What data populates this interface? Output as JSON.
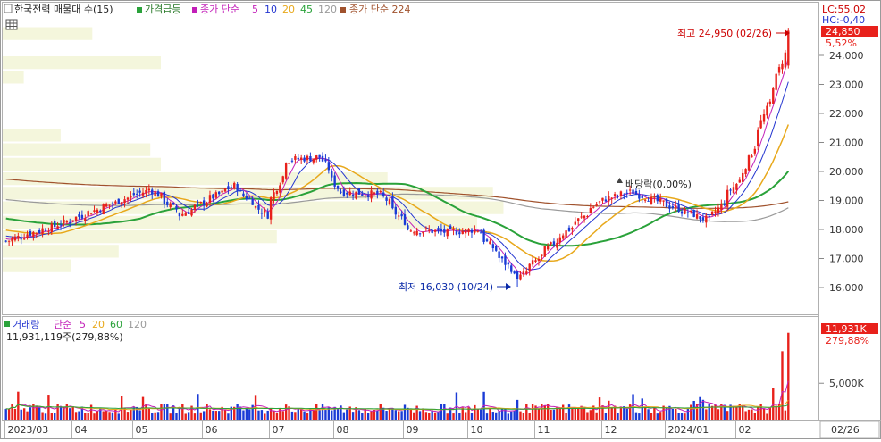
{
  "price_legend": {
    "title": "한국전력 매물대 수(15)",
    "signal": "가격급등",
    "ma_label": "종가 단순",
    "ma_periods": [
      "5",
      "10",
      "20",
      "45",
      "120"
    ],
    "ma224_label": "종가 단순 224"
  },
  "volume_legend": {
    "title": "거래량",
    "ma_label": "단순",
    "ma_periods": [
      "5",
      "20",
      "60",
      "120"
    ],
    "value": "11,931,119주(279,88%)"
  },
  "right_panel": {
    "lc": "LC:55,02",
    "hc": "HC:-0,40",
    "last_price": "24,850",
    "last_change": "5,52%",
    "last_volume": "11,931K",
    "last_volume_pct": "279,88%"
  },
  "annotations": {
    "high": "최고 24,950 (02/26)",
    "low": "최저 16,030 (10/24)",
    "dividend": "배당락(0,00%)"
  },
  "x_axis": {
    "labels": [
      "2023/03",
      "04",
      "05",
      "06",
      "07",
      "08",
      "09",
      "10",
      "11",
      "12",
      "2024/01",
      "02"
    ],
    "cursor_date": "02/26"
  },
  "colors": {
    "up": "#e8211b",
    "down": "#1a3bd6",
    "ma5": "#c21fb8",
    "ma10": "#2436d0",
    "ma20": "#e8a81b",
    "ma45": "#2aa23a",
    "ma120": "#9a9a9a",
    "ma224": "#a0522d",
    "volume_profile": "#f4f6dc",
    "high_label": "#cc0000",
    "low_label": "#0a2aa8"
  },
  "chart_data": [
    {
      "type": "candlestick",
      "name": "price",
      "y_ticks": [
        16000,
        17000,
        18000,
        19000,
        20000,
        21000,
        22000,
        23000,
        24000
      ],
      "y_tick_labels": [
        "16,000",
        "17,000",
        "18,000",
        "19,000",
        "20,000",
        "21,000",
        "22,000",
        "23,000",
        "24,000"
      ],
      "ylim": [
        15500,
        25500
      ],
      "x_range_months": [
        "2023/03",
        "2024/02"
      ],
      "key_points": [
        {
          "date": "2023/03/02",
          "close": 17600
        },
        {
          "date": "2023/03/28",
          "close": 18200
        },
        {
          "date": "2023/04/10",
          "close": 18600
        },
        {
          "date": "2023/05/08",
          "close": 19400
        },
        {
          "date": "2023/05/22",
          "close": 18500
        },
        {
          "date": "2023/06/15",
          "close": 19500
        },
        {
          "date": "2023/06/30",
          "close": 18500
        },
        {
          "date": "2023/07/10",
          "close": 20400
        },
        {
          "date": "2023/07/25",
          "close": 20500
        },
        {
          "date": "2023/08/03",
          "close": 19300
        },
        {
          "date": "2023/08/22",
          "close": 19200
        },
        {
          "date": "2023/09/04",
          "close": 18000
        },
        {
          "date": "2023/09/22",
          "close": 17900
        },
        {
          "date": "2023/10/05",
          "close": 18000
        },
        {
          "date": "2023/10/24",
          "close": 16300,
          "low": 16030
        },
        {
          "date": "2023/11/10",
          "close": 17600
        },
        {
          "date": "2023/12/01",
          "close": 19000
        },
        {
          "date": "2023/12/15",
          "close": 19300
        },
        {
          "date": "2024/01/02",
          "close": 18800
        },
        {
          "date": "2024/01/20",
          "close": 18300
        },
        {
          "date": "2024/02/05",
          "close": 20000
        },
        {
          "date": "2024/02/19",
          "close": 23000
        },
        {
          "date": "2024/02/26",
          "close": 24850,
          "high": 24950
        }
      ],
      "volume_profile": [
        {
          "from": 24500,
          "to": 25000,
          "relative": 0.17
        },
        {
          "from": 23500,
          "to": 24000,
          "relative": 0.3
        },
        {
          "from": 23000,
          "to": 23500,
          "relative": 0.04
        },
        {
          "from": 21000,
          "to": 21500,
          "relative": 0.11
        },
        {
          "from": 20500,
          "to": 21000,
          "relative": 0.28
        },
        {
          "from": 20000,
          "to": 20500,
          "relative": 0.3
        },
        {
          "from": 19500,
          "to": 20000,
          "relative": 0.73
        },
        {
          "from": 19000,
          "to": 19500,
          "relative": 0.93
        },
        {
          "from": 18500,
          "to": 19000,
          "relative": 0.95
        },
        {
          "from": 18000,
          "to": 18500,
          "relative": 0.9
        },
        {
          "from": 17500,
          "to": 18000,
          "relative": 0.52
        },
        {
          "from": 17000,
          "to": 17500,
          "relative": 0.22
        },
        {
          "from": 16500,
          "to": 17000,
          "relative": 0.13
        }
      ]
    },
    {
      "type": "bar",
      "name": "volume",
      "y_ticks": [
        5000000
      ],
      "y_tick_labels": [
        "5,000K"
      ],
      "ylim": [
        0,
        13000000
      ],
      "last_value": 11931119
    }
  ]
}
